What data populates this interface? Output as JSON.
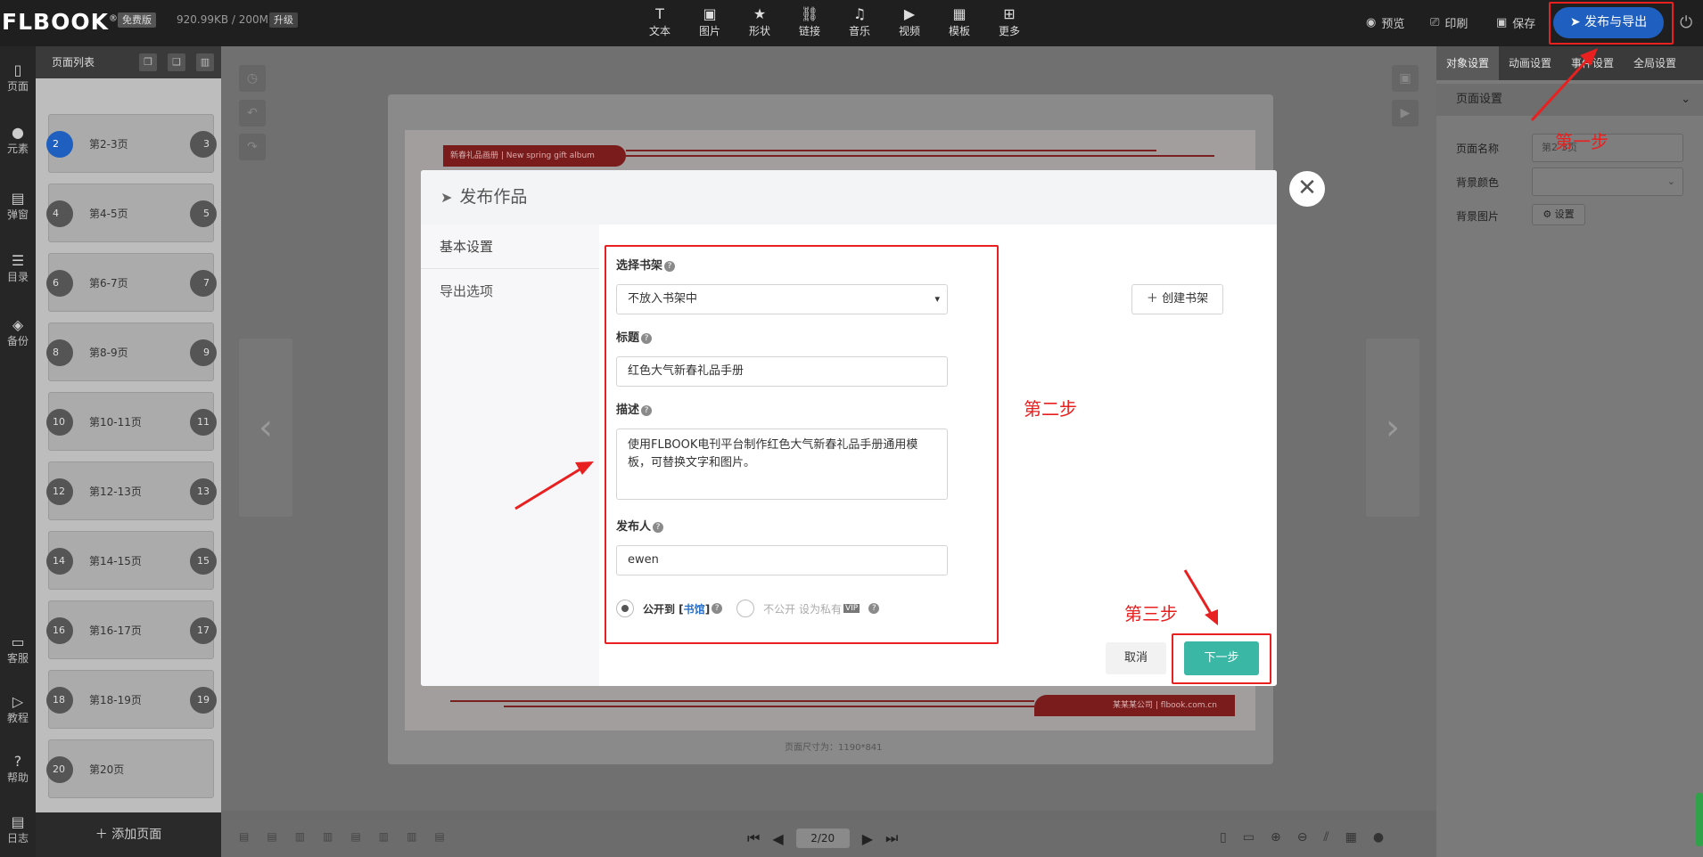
{
  "topbar": {
    "logo": "FLBOOK",
    "logo_mark": "®",
    "edition_badge": "免费版",
    "storage": "920.99KB / 200M",
    "upgrade_badge": "升级",
    "tools": [
      {
        "icon": "text-icon",
        "glyph": "T",
        "label": "文本"
      },
      {
        "icon": "image-icon",
        "glyph": "▣",
        "label": "图片"
      },
      {
        "icon": "star-icon",
        "glyph": "★",
        "label": "形状"
      },
      {
        "icon": "link-icon",
        "glyph": "⛓",
        "label": "链接"
      },
      {
        "icon": "music-icon",
        "glyph": "♫",
        "label": "音乐"
      },
      {
        "icon": "video-icon",
        "glyph": "▶",
        "label": "视频"
      },
      {
        "icon": "template-icon",
        "glyph": "▦",
        "label": "模板"
      },
      {
        "icon": "more-icon",
        "glyph": "⊞",
        "label": "更多"
      }
    ],
    "preview": "预览",
    "print": "印刷",
    "save": "保存",
    "publish": "发布与导出"
  },
  "iconbar": {
    "items": [
      {
        "label": "页面",
        "glyph": "▯"
      },
      {
        "label": "元素",
        "glyph": "●"
      },
      {
        "label": "弹窗",
        "glyph": "▤"
      },
      {
        "label": "目录",
        "glyph": "☰"
      },
      {
        "label": "备份",
        "glyph": "◈"
      }
    ],
    "bottom_items": [
      {
        "label": "客服",
        "glyph": "▭"
      },
      {
        "label": "教程",
        "glyph": "▷"
      },
      {
        "label": "帮助",
        "glyph": "?"
      },
      {
        "label": "日志",
        "glyph": "▤"
      }
    ]
  },
  "pagelist": {
    "title": "页面列表",
    "thumbs": [
      {
        "left": "2",
        "right": "3",
        "label": "第2-3页",
        "active": true
      },
      {
        "left": "4",
        "right": "5",
        "label": "第4-5页"
      },
      {
        "left": "6",
        "right": "7",
        "label": "第6-7页"
      },
      {
        "left": "8",
        "right": "9",
        "label": "第8-9页"
      },
      {
        "left": "10",
        "right": "11",
        "label": "第10-11页"
      },
      {
        "left": "12",
        "right": "13",
        "label": "第12-13页"
      },
      {
        "left": "14",
        "right": "15",
        "label": "第14-15页"
      },
      {
        "left": "16",
        "right": "17",
        "label": "第16-17页"
      },
      {
        "left": "18",
        "right": "19",
        "label": "第18-19页"
      },
      {
        "left": "20",
        "right": "",
        "label": "第20页"
      }
    ],
    "add_page": "添加页面"
  },
  "canvas": {
    "banner_top": "新春礼品画册 | New spring gift album",
    "banner_bottom": "某某某公司 | flbook.com.cn",
    "page_size": "页面尺寸为：1190*841"
  },
  "pager": {
    "current": "2/20"
  },
  "rightpanel": {
    "tabs": [
      "对象设置",
      "动画设置",
      "事件设置",
      "全局设置"
    ],
    "section": "页面设置",
    "page_name_label": "页面名称",
    "page_name_value": "第2-3页",
    "bg_color_label": "背景颜色",
    "bg_image_label": "背景图片",
    "bg_image_button": "设置"
  },
  "modal": {
    "title": "发布作品",
    "tabs": [
      "基本设置",
      "导出选项"
    ],
    "shelf_label": "选择书架",
    "shelf_value": "不放入书架中",
    "create_shelf": "创建书架",
    "title_label": "标题",
    "title_value": "红色大气新春礼品手册",
    "desc_label": "描述",
    "desc_value": "使用FLBOOK电刊平台制作红色大气新春礼品手册通用模板，可替换文字和图片。",
    "publisher_label": "发布人",
    "publisher_value": "ewen",
    "public_prefix": "公开到 [",
    "public_link": "书馆",
    "public_suffix": "]",
    "private_label": "不公开 设为私有",
    "vip_badge": "VIP",
    "cancel": "取消",
    "next": "下一步"
  },
  "annotations": {
    "step1": "第一步",
    "step2": "第二步",
    "step3": "第三步",
    "color": "#e82020"
  }
}
